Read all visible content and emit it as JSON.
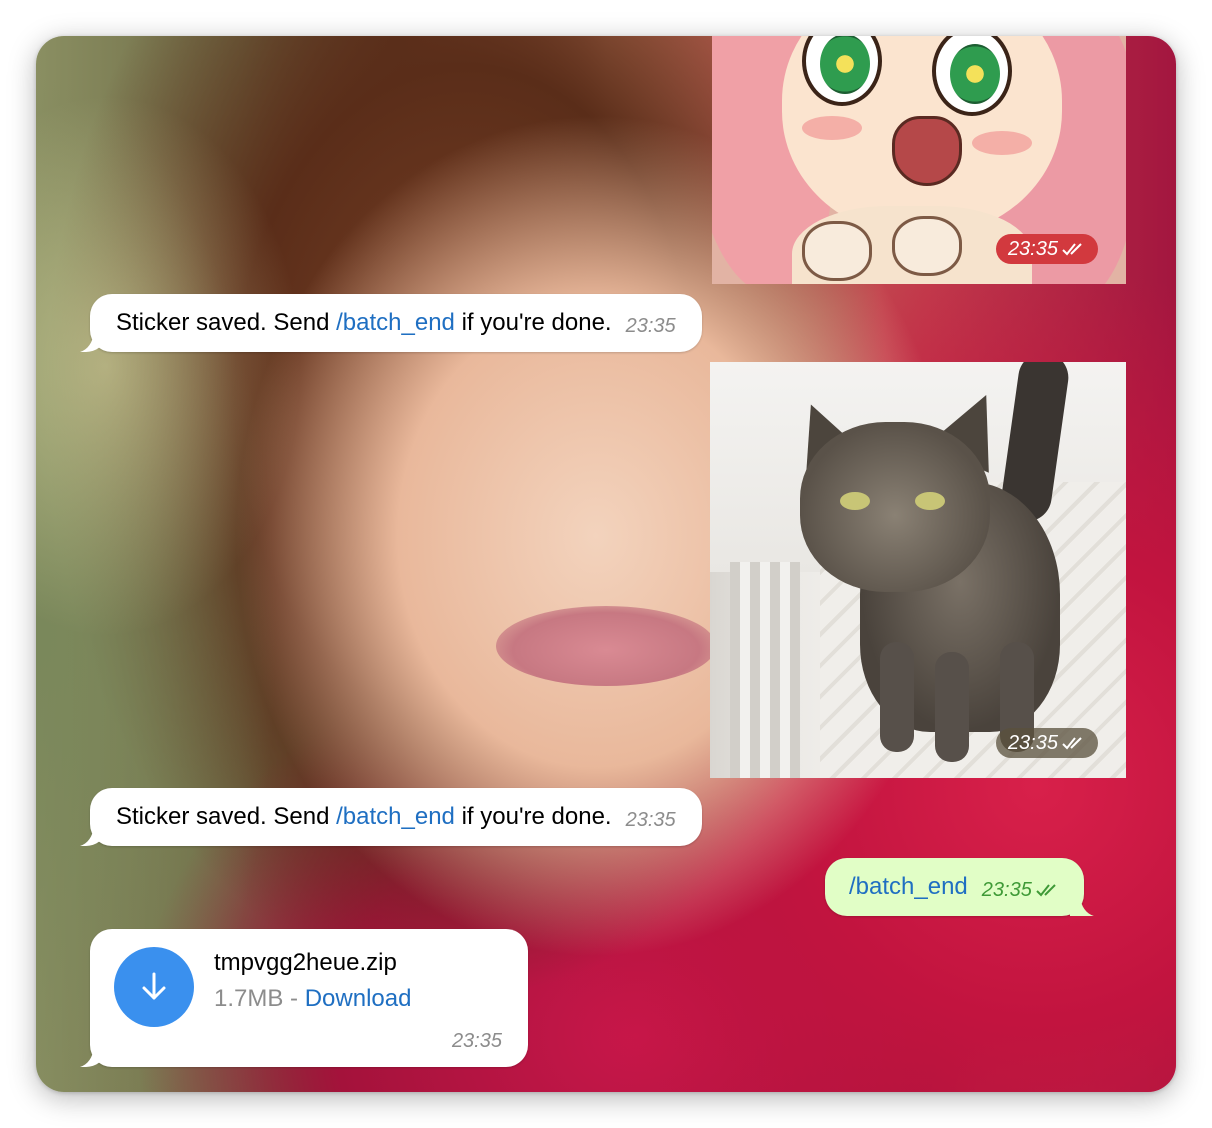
{
  "messages": [
    {
      "kind": "sticker",
      "name": "anime-sticker",
      "time": "23:35",
      "stamp_color": "#d2393e",
      "status": "double-check-icon"
    },
    {
      "kind": "text",
      "direction": "incoming",
      "text_before": "Sticker saved. Send",
      "link": "/batch_end",
      "text_after": "if you're done.",
      "time": "23:35"
    },
    {
      "kind": "sticker",
      "name": "cat-photo-sticker",
      "time": "23:35",
      "status": "double-check-icon"
    },
    {
      "kind": "text",
      "direction": "incoming",
      "text_before": "Sticker saved. Send",
      "link": "/batch_end",
      "text_after": "if you're done.",
      "time": "23:35"
    },
    {
      "kind": "text",
      "direction": "outgoing",
      "text": "/batch_end",
      "time": "23:35",
      "status": "double-check-icon"
    },
    {
      "kind": "file",
      "direction": "incoming",
      "file_name": "tmpvgg2heue.zip",
      "size": "1.7MB",
      "separator": "-",
      "action": "Download",
      "time": "23:35",
      "icon": "download-arrow-icon"
    }
  ],
  "colors": {
    "incoming_bubble": "#ffffff",
    "outgoing_bubble": "#e1fec6",
    "link": "#1f6fc2",
    "outgoing_time": "#3f9a37",
    "download_circle": "#3a90ee"
  }
}
